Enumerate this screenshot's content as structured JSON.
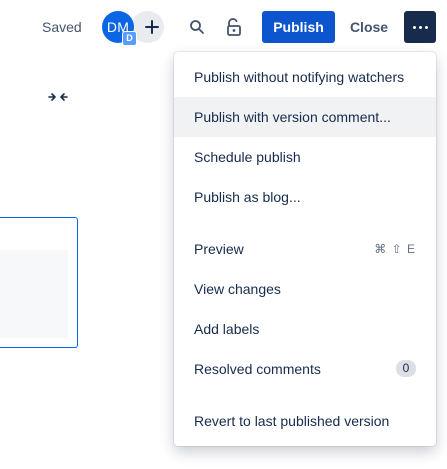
{
  "toolbar": {
    "saved_label": "Saved",
    "avatar_initials": "DM",
    "avatar_badge": "D",
    "publish_label": "Publish",
    "close_label": "Close"
  },
  "colors": {
    "primary": "#0c55cf",
    "avatar": "#0c66e4",
    "more_button": "#172b4d"
  },
  "icons": {
    "add": "plus-icon",
    "search": "search-icon",
    "lock": "lock-open-icon",
    "more": "more-horizontal-icon",
    "collapse": "collapse-horizontal-icon"
  },
  "menu": {
    "items": [
      {
        "label": "Publish without notifying watchers"
      },
      {
        "label": "Publish with version comment..."
      },
      {
        "label": "Schedule publish"
      },
      {
        "label": "Publish as blog..."
      },
      {
        "label": "Preview",
        "shortcut": "⌘ ⇧ E"
      },
      {
        "label": "View changes"
      },
      {
        "label": "Add labels"
      },
      {
        "label": "Resolved comments",
        "count": "0"
      },
      {
        "label": "Revert to last published version"
      }
    ]
  }
}
